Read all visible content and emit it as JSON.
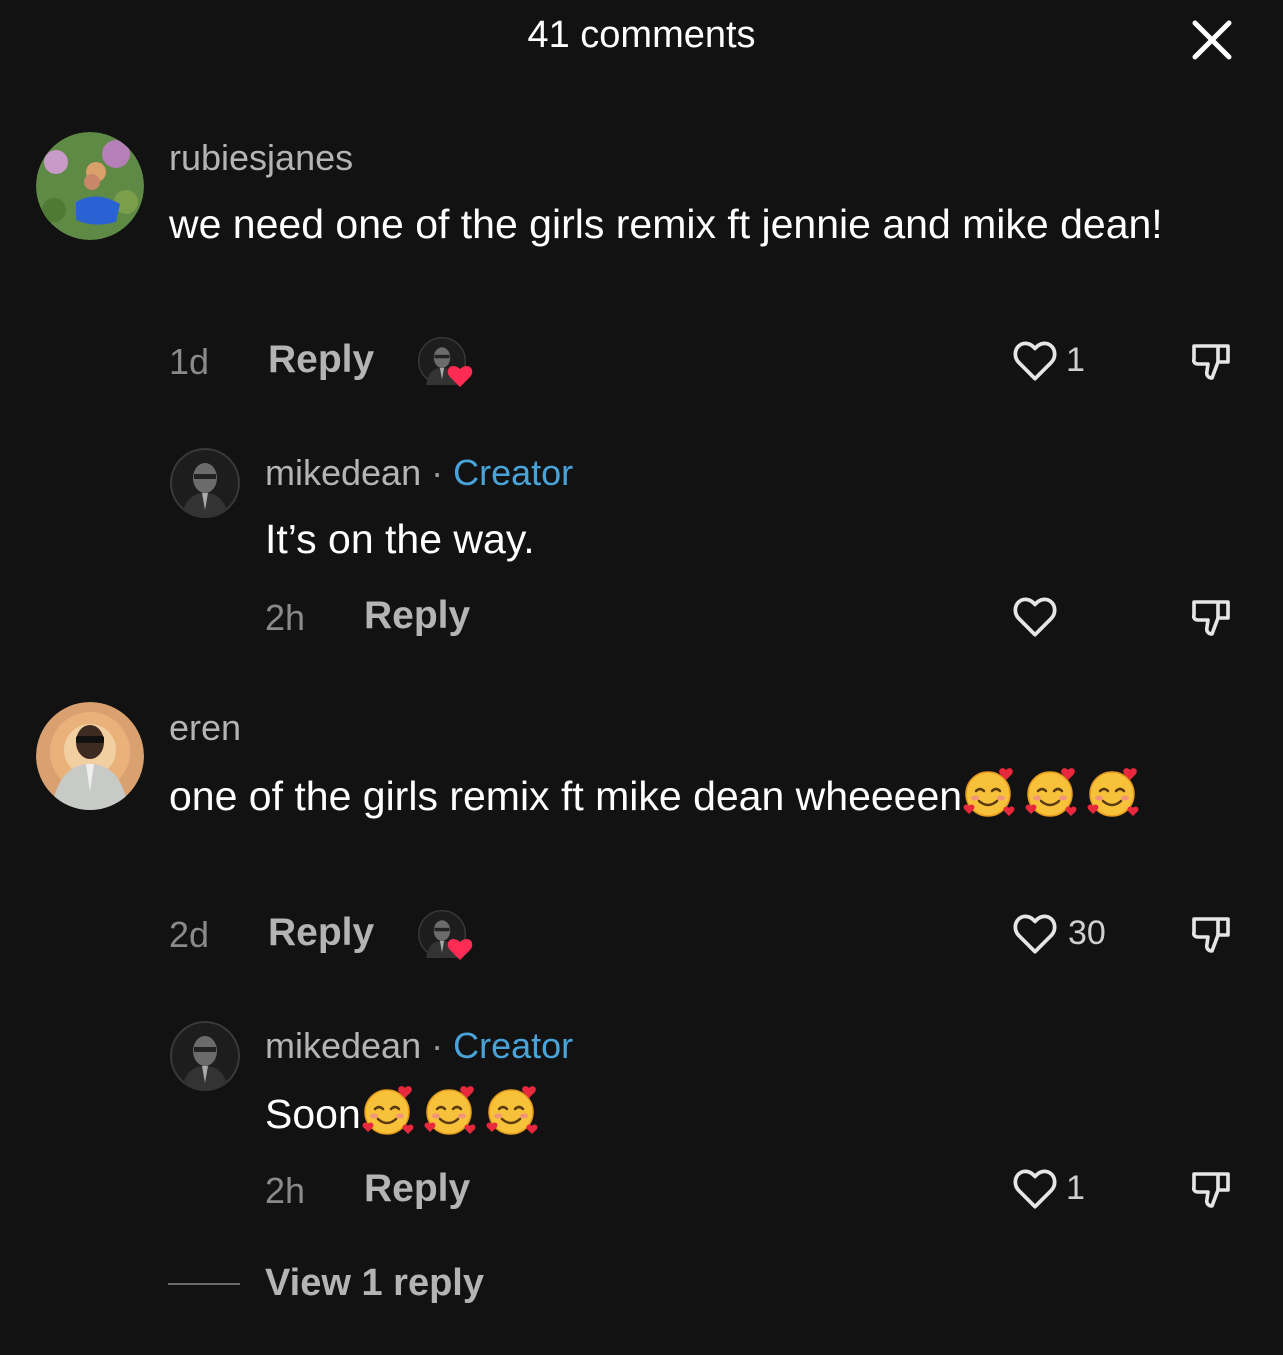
{
  "header": {
    "title": "41 comments",
    "close_icon": "close-icon"
  },
  "colors": {
    "background": "#121212",
    "creator": "#4aa3d8",
    "heart_badge": "#fe2c55"
  },
  "comments": [
    {
      "username": "rubiesjanes",
      "text": "we need one of the girls remix ft jennie and mike dean!",
      "time": "1d",
      "reply_label": "Reply",
      "likes": "1",
      "liked_by_creator": true,
      "replies": [
        {
          "username": "mikedean",
          "separator": "·",
          "badge": "Creator",
          "text": "It’s on the way.",
          "time": "2h",
          "reply_label": "Reply",
          "likes": ""
        }
      ]
    },
    {
      "username": "eren",
      "text": "one of the girls remix ft mike dean wheeeen",
      "text_emojis": [
        "smiling-face-with-hearts",
        "smiling-face-with-hearts",
        "smiling-face-with-hearts"
      ],
      "time": "2d",
      "reply_label": "Reply",
      "likes": "30",
      "liked_by_creator": true,
      "replies": [
        {
          "username": "mikedean",
          "separator": "·",
          "badge": "Creator",
          "text": "Soon",
          "text_emojis": [
            "smiling-face-with-hearts",
            "smiling-face-with-hearts",
            "smiling-face-with-hearts"
          ],
          "time": "2h",
          "reply_label": "Reply",
          "likes": "1"
        }
      ],
      "view_replies_label": "View 1 reply"
    }
  ]
}
